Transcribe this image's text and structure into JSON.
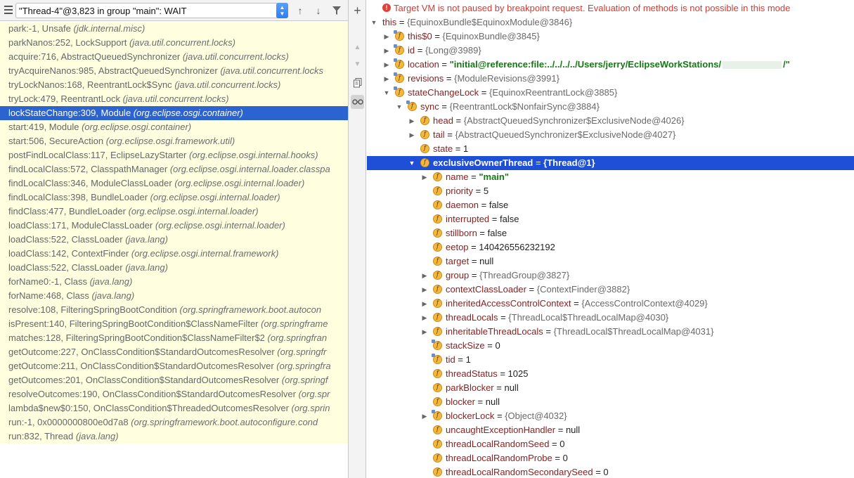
{
  "thread_bar": {
    "selected_thread": "\"Thread-4\"@3,823 in group \"main\": WAIT"
  },
  "frames": [
    {
      "method": "park:-1, Unsafe",
      "pkg": "(jdk.internal.misc)"
    },
    {
      "method": "parkNanos:252, LockSupport",
      "pkg": "(java.util.concurrent.locks)"
    },
    {
      "method": "acquire:716, AbstractQueuedSynchronizer",
      "pkg": "(java.util.concurrent.locks)"
    },
    {
      "method": "tryAcquireNanos:985, AbstractQueuedSynchronizer",
      "pkg": "(java.util.concurrent.locks"
    },
    {
      "method": "tryLockNanos:168, ReentrantLock$Sync",
      "pkg": "(java.util.concurrent.locks)"
    },
    {
      "method": "tryLock:479, ReentrantLock",
      "pkg": "(java.util.concurrent.locks)"
    },
    {
      "method": "lockStateChange:309, Module",
      "pkg": "(org.eclipse.osgi.container)"
    },
    {
      "method": "start:419, Module",
      "pkg": "(org.eclipse.osgi.container)"
    },
    {
      "method": "start:506, SecureAction",
      "pkg": "(org.eclipse.osgi.framework.util)"
    },
    {
      "method": "postFindLocalClass:117, EclipseLazyStarter",
      "pkg": "(org.eclipse.osgi.internal.hooks)"
    },
    {
      "method": "findLocalClass:572, ClasspathManager",
      "pkg": "(org.eclipse.osgi.internal.loader.classpa"
    },
    {
      "method": "findLocalClass:346, ModuleClassLoader",
      "pkg": "(org.eclipse.osgi.internal.loader)"
    },
    {
      "method": "findLocalClass:398, BundleLoader",
      "pkg": "(org.eclipse.osgi.internal.loader)"
    },
    {
      "method": "findClass:477, BundleLoader",
      "pkg": "(org.eclipse.osgi.internal.loader)"
    },
    {
      "method": "loadClass:171, ModuleClassLoader",
      "pkg": "(org.eclipse.osgi.internal.loader)"
    },
    {
      "method": "loadClass:522, ClassLoader",
      "pkg": "(java.lang)"
    },
    {
      "method": "loadClass:142, ContextFinder",
      "pkg": "(org.eclipse.osgi.internal.framework)"
    },
    {
      "method": "loadClass:522, ClassLoader",
      "pkg": "(java.lang)"
    },
    {
      "method": "forName0:-1, Class",
      "pkg": "(java.lang)"
    },
    {
      "method": "forName:468, Class",
      "pkg": "(java.lang)"
    },
    {
      "method": "resolve:108, FilteringSpringBootCondition",
      "pkg": "(org.springframework.boot.autocon"
    },
    {
      "method": "isPresent:140, FilteringSpringBootCondition$ClassNameFilter",
      "pkg": "(org.springframe"
    },
    {
      "method": "matches:128, FilteringSpringBootCondition$ClassNameFilter$2",
      "pkg": "(org.springfran"
    },
    {
      "method": "getOutcome:227, OnClassCondition$StandardOutcomesResolver",
      "pkg": "(org.springfr"
    },
    {
      "method": "getOutcome:211, OnClassCondition$StandardOutcomesResolver",
      "pkg": "(org.springfra"
    },
    {
      "method": "getOutcomes:201, OnClassCondition$StandardOutcomesResolver",
      "pkg": "(org.springf"
    },
    {
      "method": "resolveOutcomes:190, OnClassCondition$StandardOutcomesResolver",
      "pkg": "(org.spr"
    },
    {
      "method": "lambda$new$0:150, OnClassCondition$ThreadedOutcomesResolver",
      "pkg": "(org.sprin"
    },
    {
      "method": "run:-1, 0x0000000800e0d7a8",
      "pkg": "(org.springframework.boot.autoconfigure.cond"
    },
    {
      "method": "run:832, Thread",
      "pkg": "(java.lang)"
    }
  ],
  "error_message": "Target VM is not paused by breakpoint request. Evaluation of methods is not possible in this mode",
  "variables": [
    {
      "name": "this",
      "value": "{EquinoxBundle$EquinoxModule@3846}",
      "expand": "open",
      "icon": "none"
    },
    {
      "name": "this$0",
      "value": "{EquinoxBundle@3845}",
      "expand": "closed",
      "icon": "final"
    },
    {
      "name": "id",
      "value": "{Long@3989}",
      "expand": "closed",
      "icon": "final"
    },
    {
      "name": "location",
      "value": "\"initial@reference:file:../../../../Users/jerry/EclipseWorkStations/",
      "value_tail": "/\"",
      "kind": "str",
      "expand": "closed",
      "icon": "final"
    },
    {
      "name": "revisions",
      "value": "{ModuleRevisions@3991}",
      "expand": "closed",
      "icon": "final"
    },
    {
      "name": "stateChangeLock",
      "value": "{EquinoxReentrantLock@3885}",
      "expand": "open",
      "icon": "final"
    },
    {
      "name": "sync",
      "value": "{ReentrantLock$NonfairSync@3884}",
      "expand": "open",
      "icon": "final"
    },
    {
      "name": "head",
      "value": "{AbstractQueuedSynchronizer$ExclusiveNode@4026}",
      "expand": "closed",
      "icon": "field"
    },
    {
      "name": "tail",
      "value": "{AbstractQueuedSynchronizer$ExclusiveNode@4027}",
      "expand": "closed",
      "icon": "field"
    },
    {
      "name": "state",
      "value": "1",
      "kind": "num",
      "expand": "none",
      "icon": "field"
    },
    {
      "name": "exclusiveOwnerThread",
      "value": "{Thread@1}",
      "expand": "open",
      "icon": "field",
      "selected": true
    },
    {
      "name": "name",
      "value": "\"main\"",
      "kind": "str",
      "expand": "closed",
      "icon": "field"
    },
    {
      "name": "priority",
      "value": "5",
      "kind": "num",
      "expand": "none",
      "icon": "field"
    },
    {
      "name": "daemon",
      "value": "false",
      "kind": "num",
      "expand": "none",
      "icon": "field"
    },
    {
      "name": "interrupted",
      "value": "false",
      "kind": "num",
      "expand": "none",
      "icon": "field"
    },
    {
      "name": "stillborn",
      "value": "false",
      "kind": "num",
      "expand": "none",
      "icon": "field"
    },
    {
      "name": "eetop",
      "value": "140426556232192",
      "kind": "num",
      "expand": "none",
      "icon": "field"
    },
    {
      "name": "target",
      "value": "null",
      "kind": "num",
      "expand": "none",
      "icon": "field"
    },
    {
      "name": "group",
      "value": "{ThreadGroup@3827}",
      "expand": "closed",
      "icon": "field"
    },
    {
      "name": "contextClassLoader",
      "value": "{ContextFinder@3882}",
      "expand": "closed",
      "icon": "field"
    },
    {
      "name": "inheritedAccessControlContext",
      "value": "{AccessControlContext@4029}",
      "expand": "closed",
      "icon": "field"
    },
    {
      "name": "threadLocals",
      "value": "{ThreadLocal$ThreadLocalMap@4030}",
      "expand": "closed",
      "icon": "field"
    },
    {
      "name": "inheritableThreadLocals",
      "value": "{ThreadLocal$ThreadLocalMap@4031}",
      "expand": "closed",
      "icon": "field"
    },
    {
      "name": "stackSize",
      "value": "0",
      "kind": "num",
      "expand": "none",
      "icon": "final"
    },
    {
      "name": "tid",
      "value": "1",
      "kind": "num",
      "expand": "none",
      "icon": "final"
    },
    {
      "name": "threadStatus",
      "value": "1025",
      "kind": "num",
      "expand": "none",
      "icon": "field"
    },
    {
      "name": "parkBlocker",
      "value": "null",
      "kind": "num",
      "expand": "none",
      "icon": "field"
    },
    {
      "name": "blocker",
      "value": "null",
      "kind": "num",
      "expand": "none",
      "icon": "field"
    },
    {
      "name": "blockerLock",
      "value": "{Object@4032}",
      "expand": "closed",
      "icon": "final"
    },
    {
      "name": "uncaughtExceptionHandler",
      "value": "null",
      "kind": "num",
      "expand": "none",
      "icon": "field"
    },
    {
      "name": "threadLocalRandomSeed",
      "value": "0",
      "kind": "num",
      "expand": "none",
      "icon": "field"
    },
    {
      "name": "threadLocalRandomProbe",
      "value": "0",
      "kind": "num",
      "expand": "none",
      "icon": "field"
    },
    {
      "name": "threadLocalRandomSecondarySeed",
      "value": "0",
      "kind": "num",
      "expand": "none",
      "icon": "field"
    }
  ],
  "icons": {
    "menu": "hamburger-icon",
    "select_toggle": "chevron-updown-icon",
    "up": "arrow-up-icon",
    "down": "arrow-down-icon",
    "filter": "filter-icon",
    "add": "plus-icon",
    "scroll_up": "triangle-up-icon",
    "scroll_down": "triangle-down-icon",
    "copy": "copy-icon",
    "watch": "glasses-icon",
    "error": "error-icon",
    "field": "field-icon"
  },
  "colors": {
    "frames_background": "#ffffe0",
    "selection": "#2b63d0",
    "var_selection": "#1e4fd6",
    "error": "#d63a2f",
    "string_value": "#117a10",
    "field_name": "#8c1c1c",
    "field_icon": "#f4b83a"
  }
}
